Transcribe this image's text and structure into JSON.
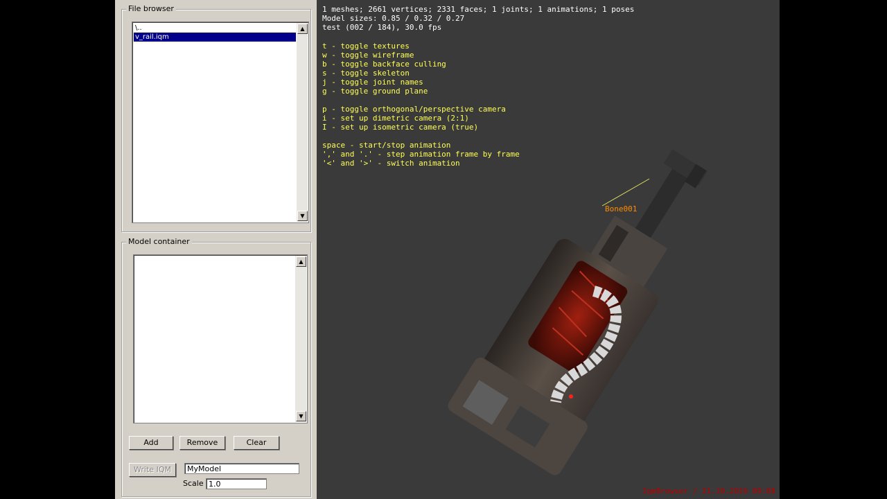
{
  "file_browser": {
    "title": "File browser",
    "items": [
      {
        "label": "\\..",
        "selected": false
      },
      {
        "label": "v_rail.iqm",
        "selected": true
      }
    ]
  },
  "model_container": {
    "title": "Model container",
    "items": [],
    "add_label": "Add",
    "remove_label": "Remove",
    "clear_label": "Clear"
  },
  "export": {
    "write_label": "Write IQM",
    "name_value": "MyModel",
    "scale_label": "Scale",
    "scale_value": "1.0"
  },
  "viewport": {
    "stats": [
      "1 meshes; 2661 vertices; 2331 faces; 1 joints; 1 animations; 1 poses",
      "Model sizes: 0.85 / 0.32 / 0.27",
      "test (002 / 184), 30.0 fps"
    ],
    "help_groups": [
      [
        "t - toggle textures",
        "w - toggle wireframe",
        "b - toggle backface culling",
        "s - toggle skeleton",
        "j - toggle joint names",
        "g - toggle ground plane"
      ],
      [
        "p - toggle orthogonal/perspective camera",
        "i - set up dimetric camera (2:1)",
        "I - set up isometric camera (true)"
      ],
      [
        "space - start/stop animation",
        "',' and '.' - step animation frame by frame",
        "'<' and '>' - switch animation"
      ]
    ],
    "bone_label": "Bone001",
    "footer": "IqmBrowser / 21.10.2016 09:08"
  },
  "colors": {
    "panel": "#d4d0c8",
    "viewport_bg": "#3a3a3a",
    "help_text": "#ffff55",
    "bone_label": "#ff8c00",
    "selection": "#00008b"
  }
}
